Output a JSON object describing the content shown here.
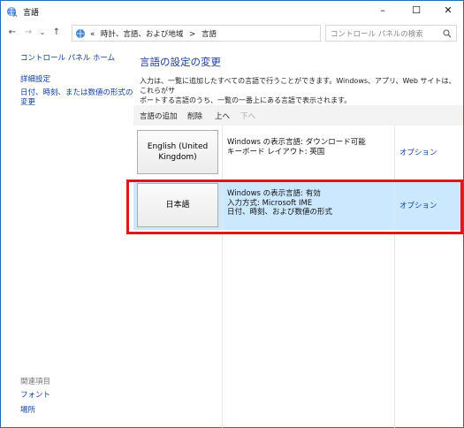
{
  "window": {
    "title": "言語"
  },
  "nav": {
    "back": "←",
    "forward": "→",
    "recent": "⌄",
    "up": "↑"
  },
  "address": {
    "crumbs": [
      "«",
      "時計、言語、および地域",
      ">",
      "言語"
    ],
    "dropdown": "⌄",
    "refresh": "↻"
  },
  "search": {
    "placeholder": "コントロール パネルの検索",
    "icon": "search-icon"
  },
  "sidebar": {
    "home": "コントロール パネル ホーム",
    "advanced": "詳細設定",
    "datetime_line1": "日付、時刻、または数値の形式の",
    "datetime_line2": "変更",
    "related_heading": "関連項目",
    "fonts": "フォント",
    "location": "場所"
  },
  "main": {
    "title": "言語の設定の変更",
    "desc_line1": "入力は、一覧に追加したすべての言語で行うことができます。Windows、アプリ、Web サイトは、これらがサ",
    "desc_line2": "ポートする言語のうち、一覧の一番上にある言語で表示されます。"
  },
  "toolbar": {
    "add": "言語の追加",
    "remove": "削除",
    "up": "上へ",
    "down": "下へ"
  },
  "languages": [
    {
      "name_line1": "English (United",
      "name_line2": "Kingdom)",
      "info1": "Windows の表示言語: ダウンロード可能",
      "info2": "キーボード レイアウト: 英国",
      "info3": "",
      "options": "オプション"
    },
    {
      "name_line1": "日本語",
      "name_line2": "",
      "info1": "Windows の表示言語: 有効",
      "info2": "入力方式: Microsoft IME",
      "info3": "日付、時刻、および数値の形式",
      "options": "オプション"
    }
  ],
  "colors": {
    "link": "#0c3c9e",
    "selected_row": "#cce8ff",
    "highlight_border": "#e3141b",
    "title": "#1e3e9a"
  }
}
